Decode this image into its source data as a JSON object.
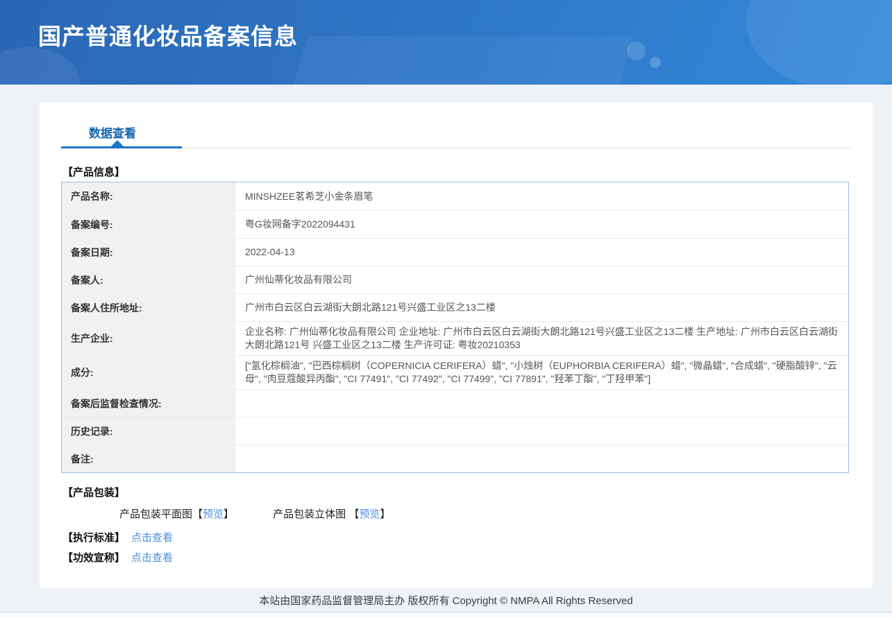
{
  "header": {
    "title": "国产普通化妆品备案信息"
  },
  "tab": {
    "label": "数据查看"
  },
  "product_info": {
    "title": "【产品信息】",
    "rows": [
      {
        "label": "产品名称:",
        "value": "MINSHZEE茗希芝小金条眉笔"
      },
      {
        "label": "备案编号:",
        "value": "粤G妆网备字2022094431"
      },
      {
        "label": "备案日期:",
        "value": "2022-04-13"
      },
      {
        "label": "备案人:",
        "value": "广州仙蒂化妆品有限公司"
      },
      {
        "label": "备案人住所地址:",
        "value": "广州市白云区白云湖街大朗北路121号兴盛工业区之13二楼"
      },
      {
        "label": "生产企业:",
        "value": "企业名称: 广州仙蒂化妆品有限公司 企业地址: 广州市白云区白云湖街大朗北路121号兴盛工业区之13二楼 生产地址: 广州市白云区白云湖街大朗北路121号 兴盛工业区之13二楼 生产许可证: 粤妆20210353"
      },
      {
        "label": "成分:",
        "value": "[\"氢化棕榈油\", \"巴西棕榈树（COPERNICIA CERIFERA）蜡\", \"小烛树（EUPHORBIA CERIFERA）蜡\", \"微晶蜡\", \"合成蜡\", \"硬脂酸锌\", \"云母\", \"肉豆蔻酸异丙酯\", \"CI 77491\", \"CI 77492\", \"CI 77499\", \"CI 77891\", \"羟苯丁酯\", \"丁羟甲苯\"]"
      },
      {
        "label": "备案后监督检查情况:",
        "value": ""
      },
      {
        "label": "历史记录:",
        "value": ""
      },
      {
        "label": "备注:",
        "value": ""
      }
    ]
  },
  "packaging": {
    "title": "【产品包装】",
    "bracket_open": "【",
    "bracket_close": "】",
    "items": [
      {
        "label": "产品包装平面图",
        "link": "预览"
      },
      {
        "label": "产品包装立体图 ",
        "link": "预览"
      }
    ]
  },
  "standard": {
    "title": "【执行标准】",
    "link": "点击查看"
  },
  "efficacy": {
    "title": "【功效宣称】",
    "link": "点击查看"
  },
  "footer": {
    "text": "本站由国家药品监督管理局主办 版权所有 Copyright © NMPA All Rights Reserved"
  },
  "colors": {
    "accent_blue": "#1b75cb",
    "tab_text": "#1565b0",
    "link_blue": "#4a90db",
    "table_border": "#a3bedd",
    "header_gradient_start": "#2a67b4",
    "header_gradient_end": "#3488da"
  }
}
